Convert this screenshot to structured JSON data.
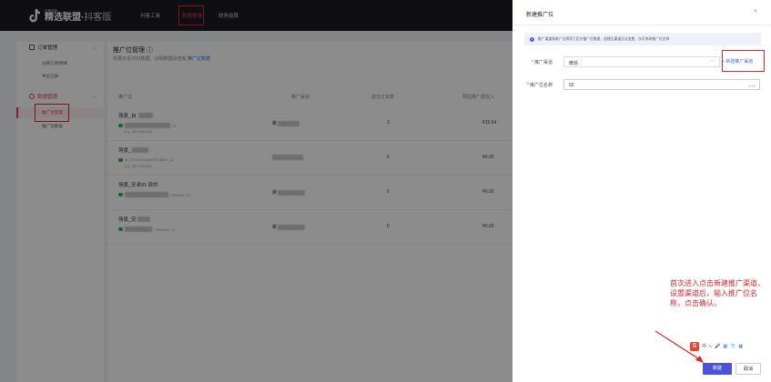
{
  "header": {
    "logo_small": "抖音电商",
    "logo_main": "精选联盟",
    "logo_sub": "抖客版",
    "nav": [
      {
        "label": "抖客工具",
        "active": false
      },
      {
        "label": "数据参谋",
        "active": true
      },
      {
        "label": "财务结算",
        "active": false
      }
    ]
  },
  "sidebar": {
    "groups": [
      {
        "label": "订单管理",
        "items": [
          "分销订单明细",
          "导出记录"
        ]
      },
      {
        "label": "数据管理",
        "items": [
          "推广位管理",
          "推广位数据"
        ]
      }
    ],
    "active_item": "推广位管理"
  },
  "content": {
    "title": "推广位管理",
    "description": "仅展示近30日数据，详细数据请查看",
    "description_link": "推广位数据",
    "columns": [
      "推广位",
      "推广渠道",
      "成交订单数",
      "预估推广费收入"
    ],
    "rows": [
      {
        "name": "场景_自",
        "id_line1": "_21",
        "id_line2": "174_3527552283",
        "channel": "聚",
        "orders": "3",
        "income": "¥19.64"
      },
      {
        "name": "场景_",
        "id_line1": "id_7072400008007816460_21",
        "id_line2": "174_3527341841",
        "channel": "",
        "orders": "0",
        "income": "¥0.00"
      },
      {
        "name": "场景_安卓81-软件",
        "id_line1": "_7816460_21",
        "id_line2": "",
        "channel": "聚",
        "orders": "0",
        "income": "¥0.00"
      },
      {
        "name": "场景_安",
        "id_line1": "...7816460_21",
        "id_line2": "",
        "channel": "聚",
        "orders": "0",
        "income": "¥0.00"
      }
    ]
  },
  "drawer": {
    "title": "新建推广位",
    "close_icon": "close-icon",
    "notice": "推广渠道和推广位将用于区分推广位数据，创建后渠道无法变更，仅可修改推广位名称",
    "channel_label": "推广渠道",
    "channel_value": "微信",
    "new_channel_link": "+ 新建推广渠道",
    "name_label": "推广位名称",
    "name_value": "02",
    "name_count": "2/20",
    "annotation": "首次进入点击新建推广渠道，设置渠道后，输入推广位名称，点击确认。",
    "ime_items": [
      "中",
      "•,",
      "🎤",
      "▦",
      "👕",
      "▦"
    ],
    "confirm_label": "新建",
    "cancel_label": "取消"
  },
  "colors": {
    "accent": "#e23b5c",
    "primary": "#4d53d8",
    "highlight_box": "#e5262d"
  }
}
